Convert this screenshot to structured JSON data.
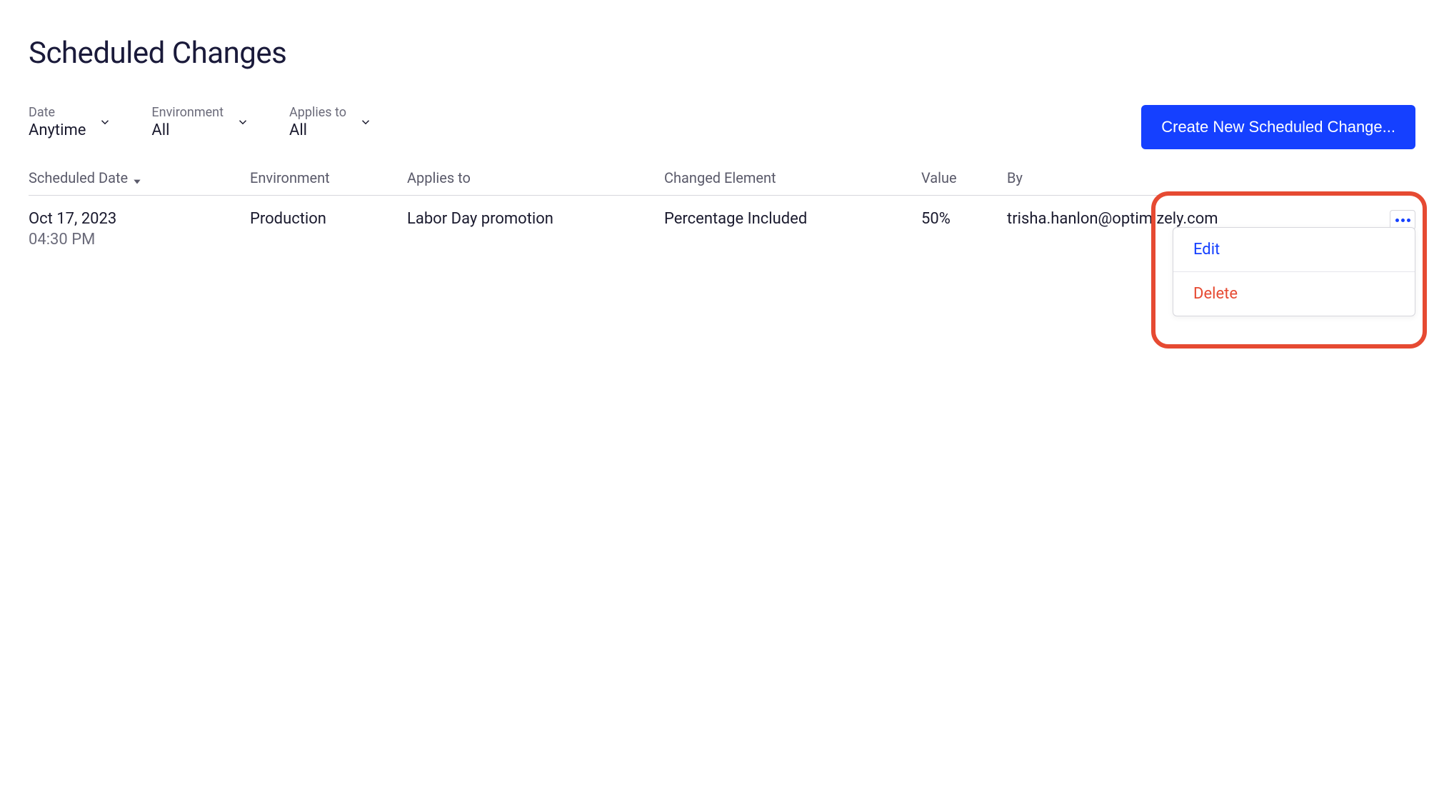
{
  "page": {
    "title": "Scheduled Changes"
  },
  "filters": {
    "date": {
      "label": "Date",
      "value": "Anytime"
    },
    "environment": {
      "label": "Environment",
      "value": "All"
    },
    "applies_to": {
      "label": "Applies to",
      "value": "All"
    }
  },
  "actions": {
    "create_button": "Create New Scheduled Change..."
  },
  "table": {
    "headers": {
      "scheduled_date": "Scheduled Date",
      "environment": "Environment",
      "applies_to": "Applies to",
      "changed_element": "Changed Element",
      "value": "Value",
      "by": "By"
    },
    "rows": [
      {
        "date": "Oct 17, 2023",
        "time": "04:30 PM",
        "environment": "Production",
        "applies_to": "Labor Day promotion",
        "changed_element": "Percentage Included",
        "value": "50%",
        "by": "trisha.hanlon@optimizely.com"
      }
    ]
  },
  "row_menu": {
    "edit": "Edit",
    "delete": "Delete"
  }
}
